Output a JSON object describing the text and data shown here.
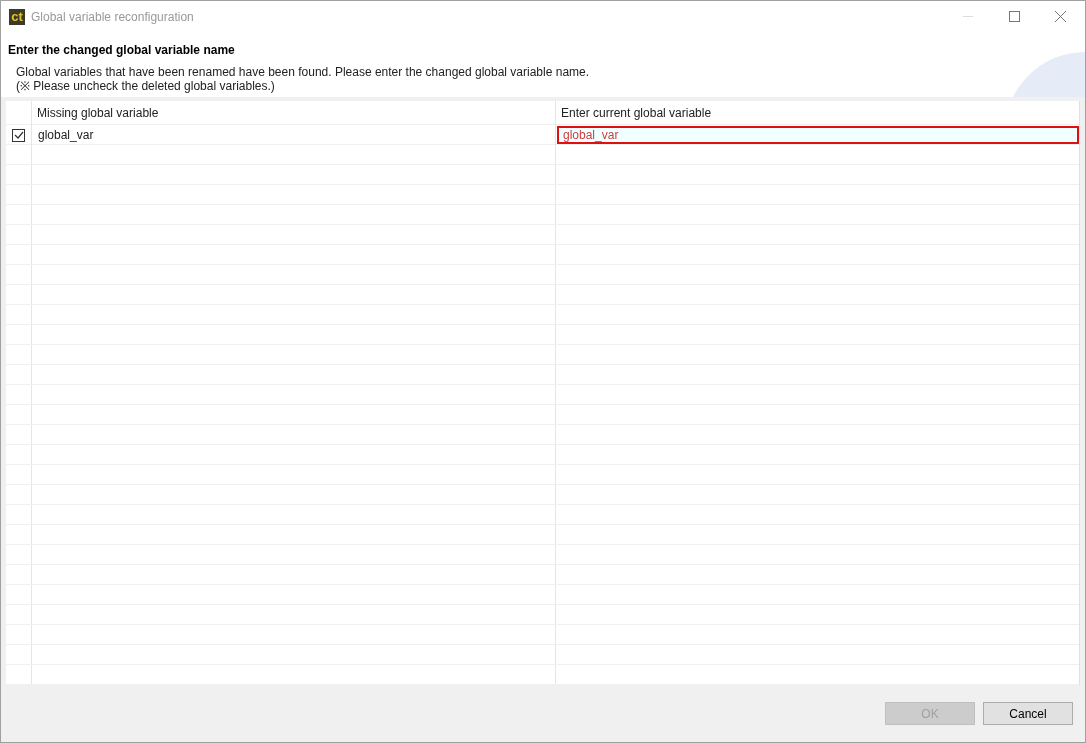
{
  "window": {
    "title": "Global variable reconfiguration",
    "app_icon": "ct"
  },
  "header": {
    "title": "Enter the changed global variable name",
    "message": "Global variables that have been renamed have been found. Please enter the changed global variable name.",
    "note": "(※ Please uncheck the deleted global variables.)"
  },
  "table": {
    "columns": [
      "Missing global variable",
      "Enter current global variable"
    ],
    "rows": [
      {
        "checked": true,
        "missing": "global_var",
        "current": "global_var",
        "invalid": true
      }
    ]
  },
  "buttons": [
    {
      "label": "OK",
      "disabled": true
    },
    {
      "label": "Cancel",
      "disabled": false
    }
  ]
}
